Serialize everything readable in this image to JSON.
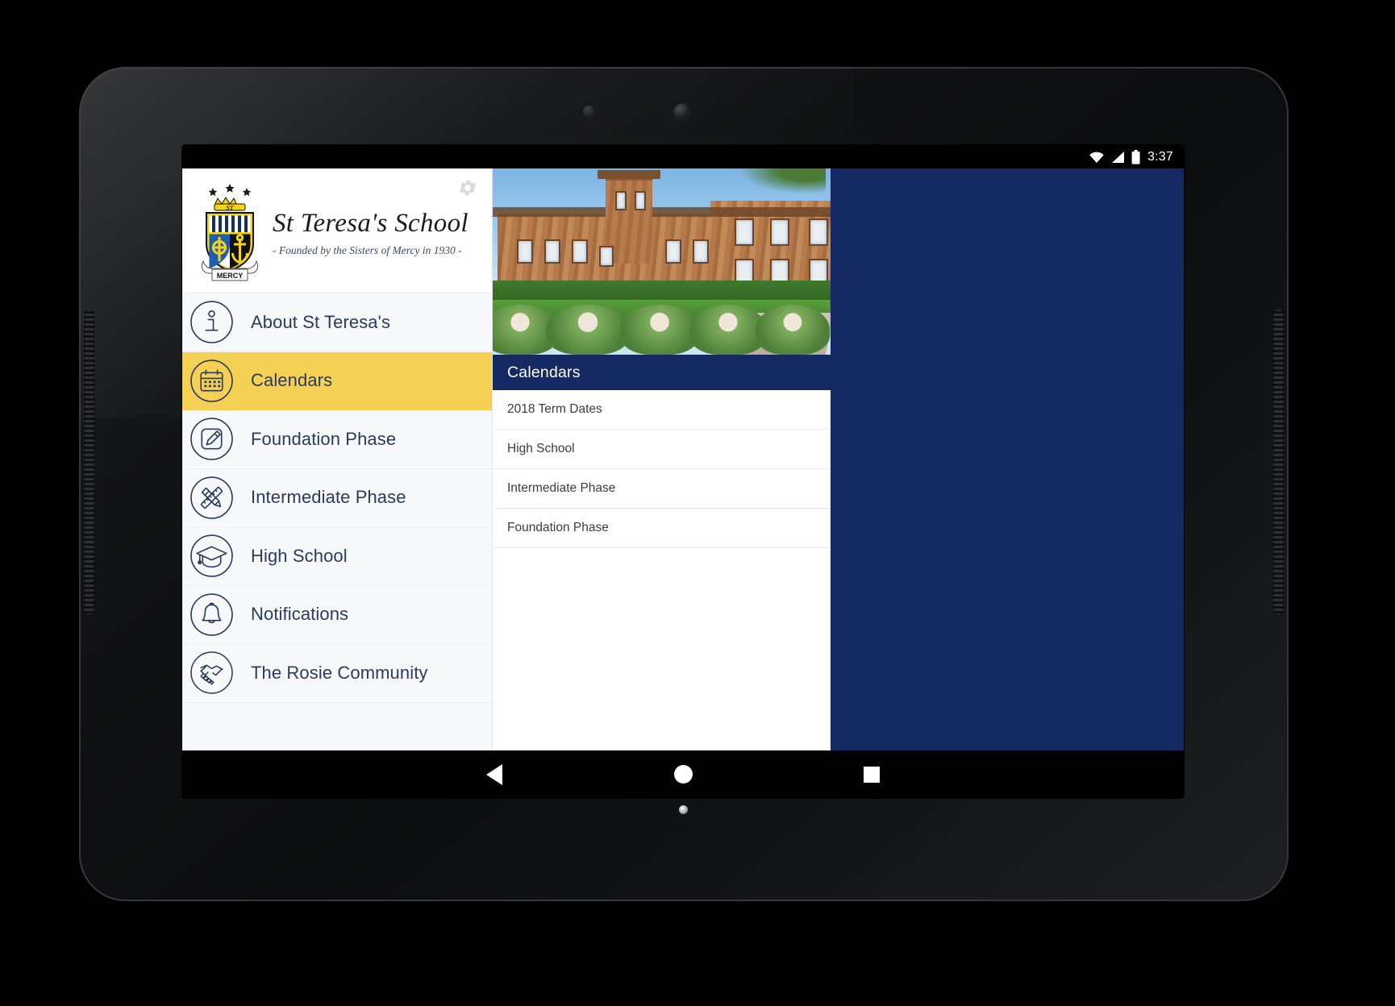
{
  "status_bar": {
    "clock": "3:37",
    "icons": [
      "wifi-icon",
      "signal-icon",
      "battery-icon"
    ]
  },
  "brand": {
    "title": "St Teresa's School",
    "subtitle": "-  Founded by the Sisters of Mercy in 1930  -",
    "crest_motto": "MERCY",
    "crest_monogram": "ST",
    "settings_icon": "gear-icon"
  },
  "sidebar": {
    "items": [
      {
        "label": "About St Teresa's",
        "icon": "info-icon",
        "active": false
      },
      {
        "label": "Calendars",
        "icon": "calendar-icon",
        "active": true
      },
      {
        "label": "Foundation Phase",
        "icon": "pencil-edit-icon",
        "active": false
      },
      {
        "label": "Intermediate Phase",
        "icon": "ruler-pencil-icon",
        "active": false
      },
      {
        "label": "High School",
        "icon": "graduation-cap-icon",
        "active": false
      },
      {
        "label": "Notifications",
        "icon": "bell-icon",
        "active": false
      },
      {
        "label": "The Rosie Community",
        "icon": "handshake-icon",
        "active": false
      }
    ]
  },
  "content": {
    "hero_alt": "school-building-photo",
    "section_title": "Calendars",
    "list_items": [
      {
        "label": "2018 Term Dates"
      },
      {
        "label": "High School"
      },
      {
        "label": "Intermediate Phase"
      },
      {
        "label": "Foundation Phase"
      }
    ]
  },
  "nav_bar": {
    "back": "back-button",
    "home": "home-button",
    "recents": "recents-button"
  },
  "colors": {
    "navy": "#152a62",
    "accent_yellow": "#f4d055",
    "sidebar_bg": "#f7f8f9",
    "text_navy": "#2b3a60"
  }
}
